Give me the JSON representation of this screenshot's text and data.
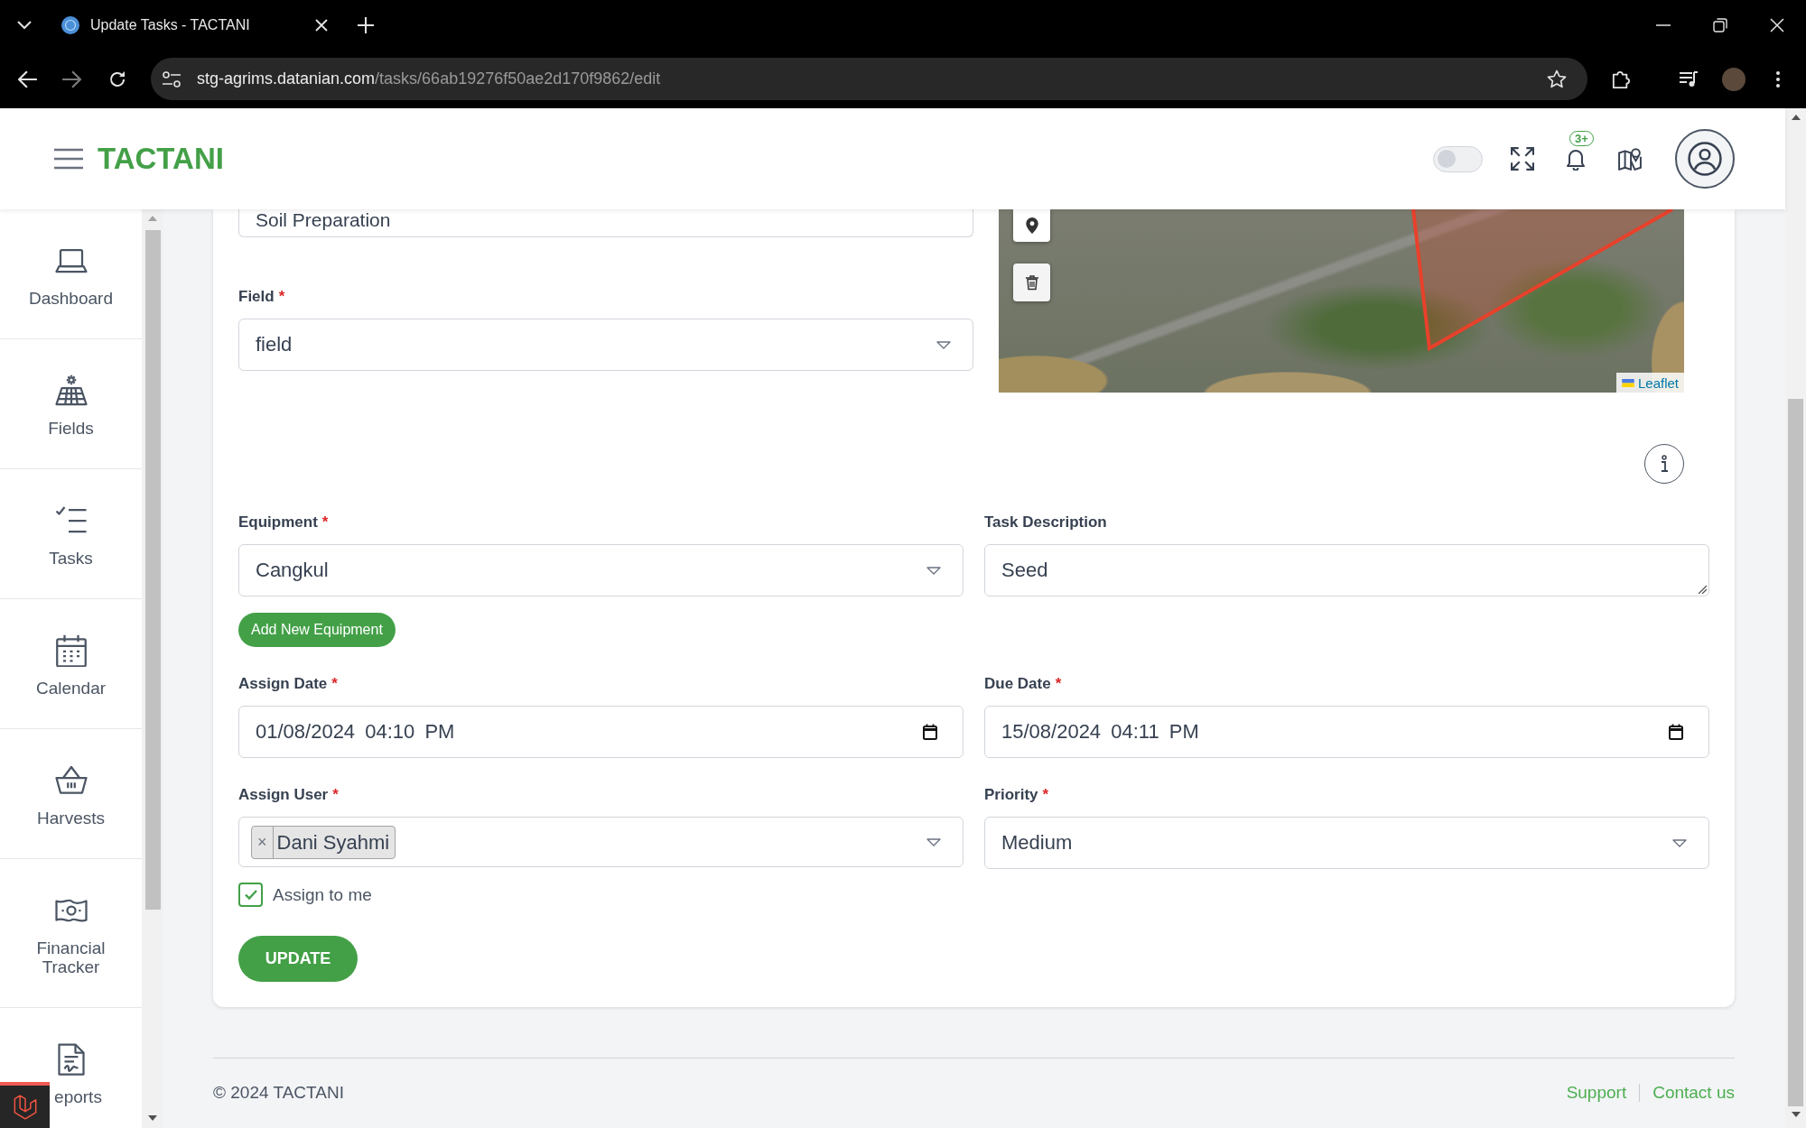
{
  "browser": {
    "tab": {
      "title": "Update Tasks - TACTANI"
    },
    "url": {
      "host": "stg-agrims.datanian.com",
      "path": "/tasks/66ab19276f50ae2d170f9862/edit"
    }
  },
  "header": {
    "brand": "TACTANI",
    "theme_toggle": {
      "on": false
    },
    "notifications": {
      "badge": "3+"
    }
  },
  "sidebar": {
    "items": [
      {
        "label": "Dashboard",
        "selected": false
      },
      {
        "label": "Fields",
        "selected": false
      },
      {
        "label": "Tasks",
        "selected": false
      },
      {
        "label": "Calendar",
        "selected": false
      },
      {
        "label": "Harvests",
        "selected": false
      },
      {
        "label": "Financial Tracker",
        "selected": false
      },
      {
        "label": "eports",
        "selected": false
      }
    ]
  },
  "form": {
    "required_mark": "*",
    "partial_input": {
      "value": "Soil Preparation"
    },
    "field": {
      "label": "Field",
      "required": true,
      "kind": "select",
      "value": "field"
    },
    "map": {
      "attribution": "Leaflet"
    },
    "rows": [
      [
        {
          "label": "Equipment",
          "required": true,
          "kind": "select",
          "value": "Cangkul",
          "action": "Add New Equipment"
        },
        {
          "label": "Task Description",
          "required": false,
          "kind": "textarea",
          "value": "Seed"
        }
      ],
      [
        {
          "label": "Assign Date",
          "required": true,
          "kind": "datetime",
          "value": "01/08/2024 04:10 PM"
        },
        {
          "label": "Due Date",
          "required": true,
          "kind": "datetime",
          "value": "15/08/2024 04:11 PM"
        }
      ],
      [
        {
          "label": "Assign User",
          "required": true,
          "kind": "multiselect",
          "tags": [
            "Dani Syahmi"
          ],
          "remove_label": "×",
          "checkbox": {
            "label": "Assign to me",
            "checked": true
          }
        },
        {
          "label": "Priority",
          "required": true,
          "kind": "select",
          "value": "Medium"
        }
      ]
    ],
    "submit": "UPDATE"
  },
  "footer": {
    "copyright": "© 2024 TACTANI",
    "links": [
      "Support",
      "Contact us"
    ]
  }
}
